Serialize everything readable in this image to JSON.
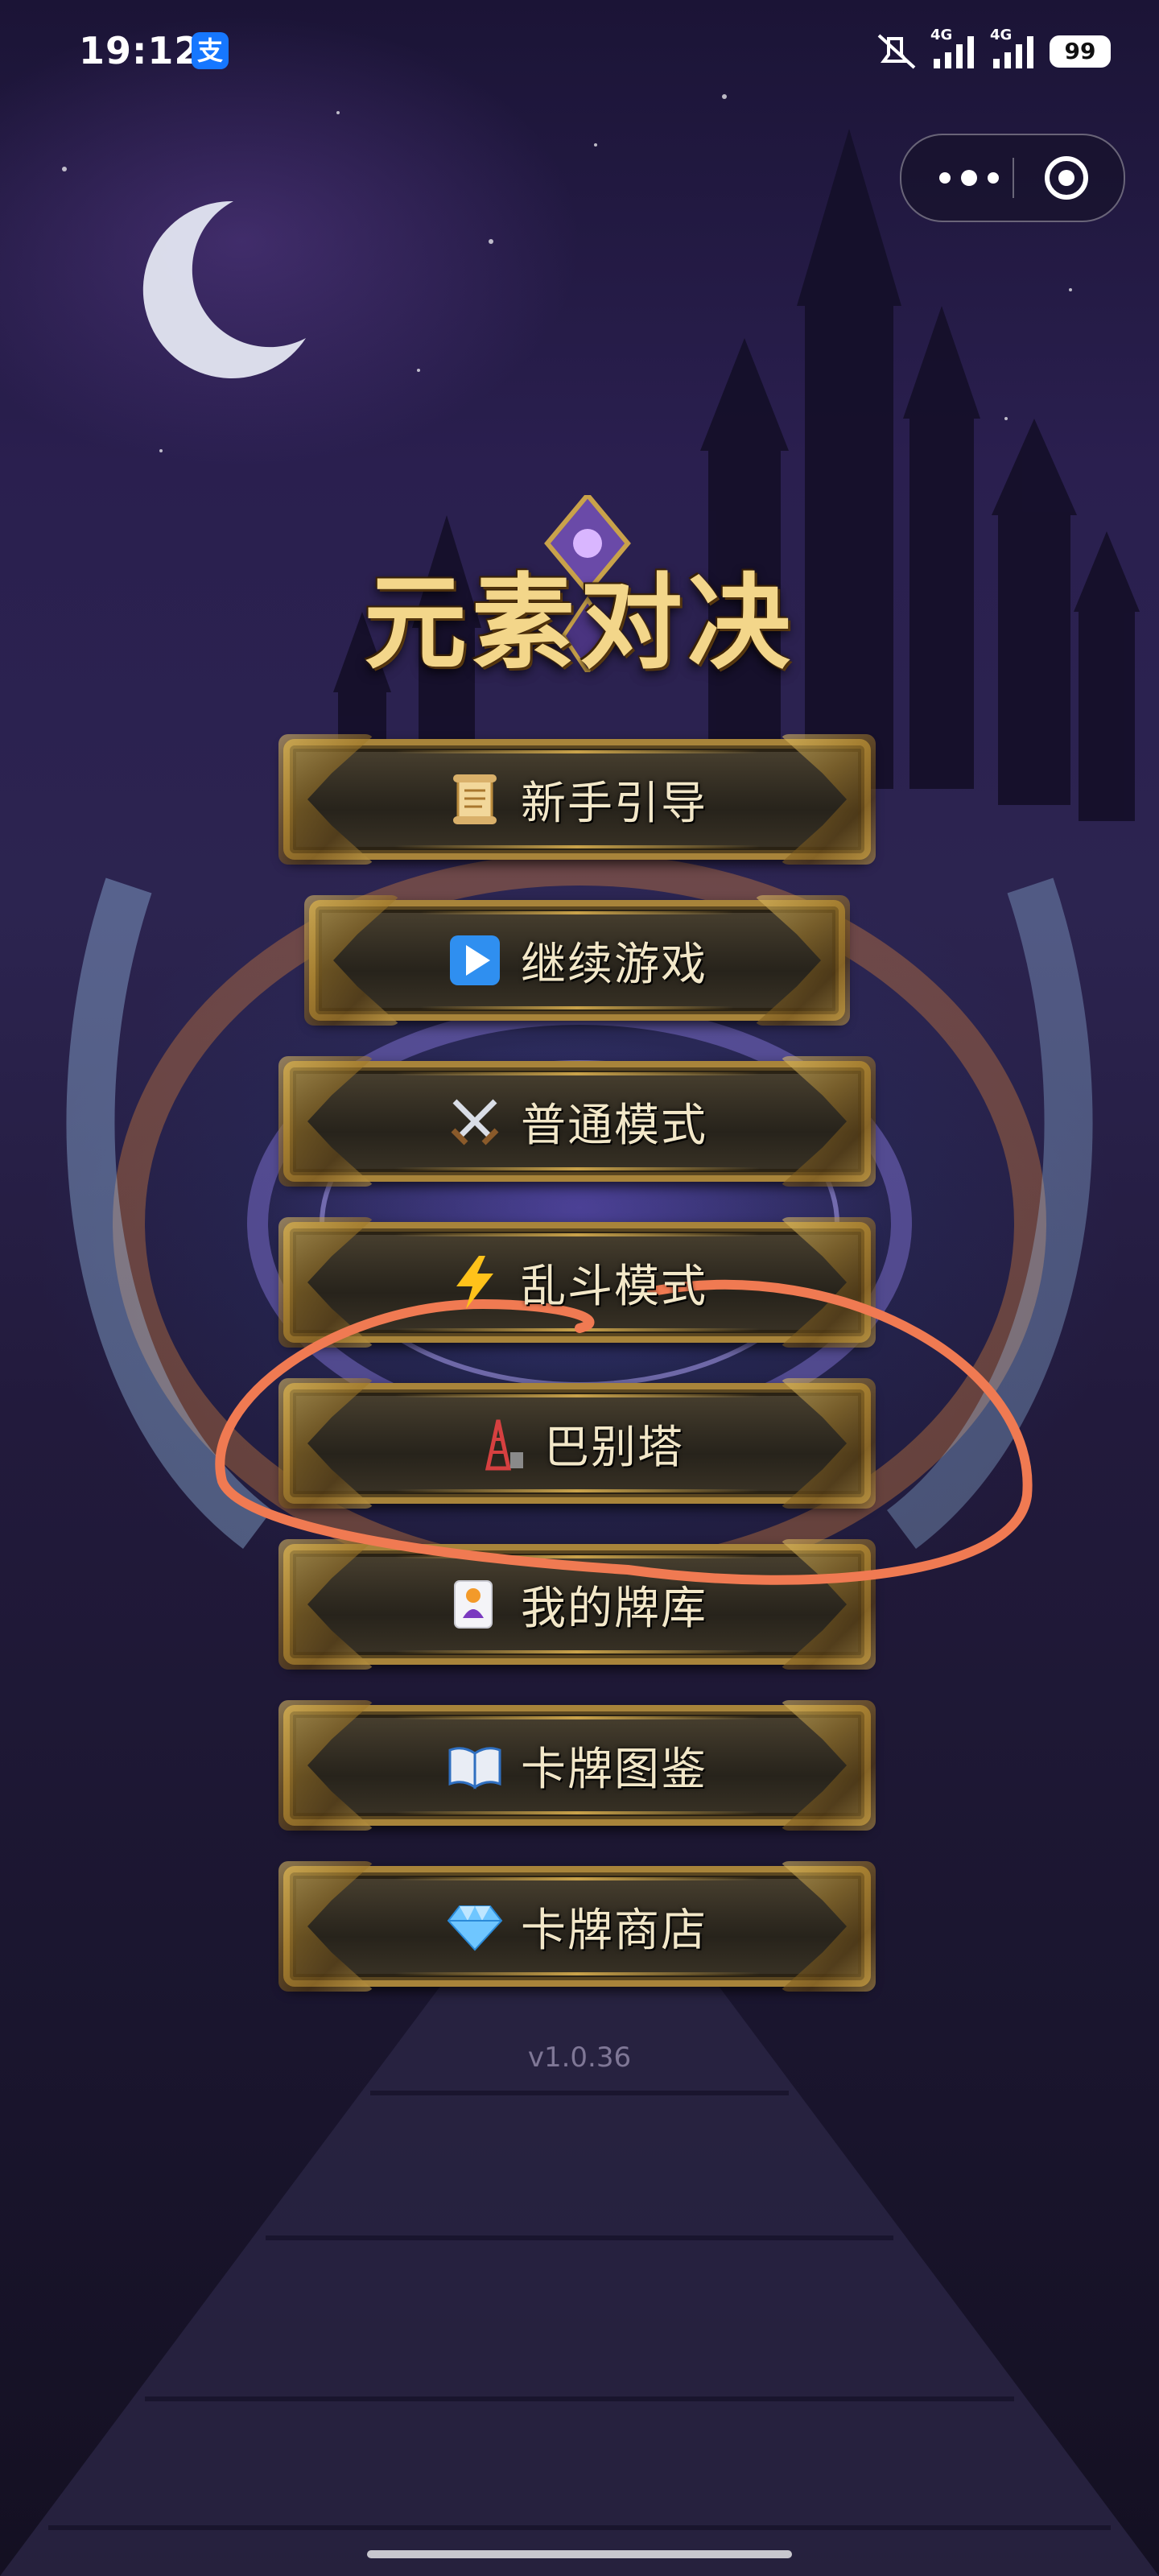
{
  "status_bar": {
    "time": "19:12",
    "app_badge": "支",
    "signal_1": "4G",
    "signal_2": "4G",
    "battery": "99"
  },
  "capsule": {
    "more_icon": "more-dots-icon",
    "close_icon": "target-close-icon"
  },
  "game": {
    "title": "元素对决",
    "version": "v1.0.36"
  },
  "menu": [
    {
      "label": "新手引导",
      "icon": "scroll-icon"
    },
    {
      "label": "继续游戏",
      "icon": "play-icon"
    },
    {
      "label": "普通模式",
      "icon": "crossed-swords-icon"
    },
    {
      "label": "乱斗模式",
      "icon": "lightning-icon"
    },
    {
      "label": "巴别塔",
      "icon": "tower-icon"
    },
    {
      "label": "我的牌库",
      "icon": "card-deck-icon"
    },
    {
      "label": "卡牌图鉴",
      "icon": "book-icon"
    },
    {
      "label": "卡牌商店",
      "icon": "diamond-icon"
    }
  ],
  "colors": {
    "title_gold": "#f3d68a",
    "button_border": "#a8843a",
    "annotation_stroke": "#f07a52"
  }
}
